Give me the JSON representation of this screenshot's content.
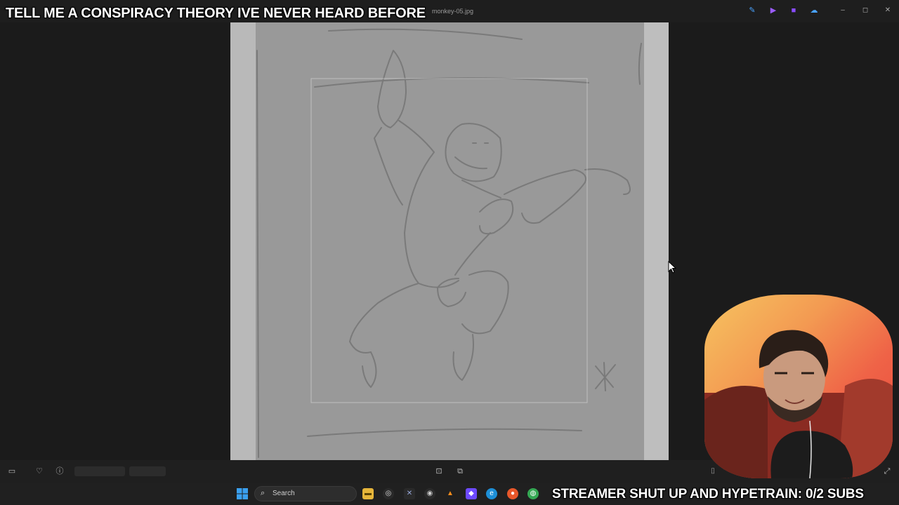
{
  "window": {
    "file_title": "monkey-05.jpg",
    "controls": {
      "minimize": "–",
      "maximize": "◻",
      "close": "✕"
    },
    "title_icons": [
      "edit-icon",
      "draw-icon",
      "video-icon",
      "cloud-icon"
    ]
  },
  "stream_overlay": {
    "top_text": "TELL ME A CONSPIRACY THEORY IVE NEVER HEARD BEFORE",
    "bottom_text": "STREAMER SHUT UP AND HYPETRAIN: 0/2 SUBS"
  },
  "viewer_toolbar": {
    "left_icons": [
      "filmstrip-icon",
      "heart-icon",
      "info-icon"
    ],
    "center_icons": [
      "fit-icon",
      "crop-icon"
    ],
    "right_icons": [
      "screenshot-icon",
      "fullscreen-icon"
    ]
  },
  "taskbar": {
    "search_placeholder": "Search",
    "apps": [
      "file-explorer",
      "obs",
      "xbox",
      "davinci",
      "vlc",
      "proton",
      "edge",
      "firefox",
      "chrome"
    ]
  },
  "colors": {
    "background": "#1b1b1b",
    "paper": "#9b9b9b",
    "taskbar": "#202020",
    "webcam_gradient": [
      "#f6c460",
      "#e8463c"
    ]
  }
}
